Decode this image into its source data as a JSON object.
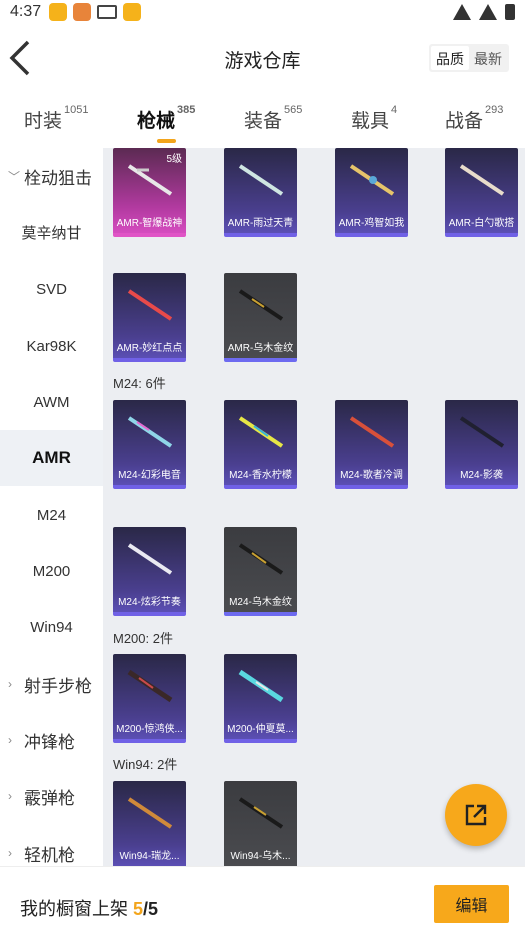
{
  "status": {
    "time": "4:37",
    "icons": [
      "app-icon",
      "app-icon",
      "mail-icon",
      "app-icon"
    ],
    "right_icons": [
      "wifi-icon",
      "signal-icon",
      "battery-icon"
    ]
  },
  "header": {
    "title": "游戏仓库",
    "sort_quality": "品质",
    "sort_newest": "最新"
  },
  "tabs": [
    {
      "label": "时装",
      "count": "1051"
    },
    {
      "label": "枪械",
      "count": "385"
    },
    {
      "label": "装备",
      "count": "565"
    },
    {
      "label": "载具",
      "count": "4"
    },
    {
      "label": "战备",
      "count": "293"
    }
  ],
  "sidebar": {
    "items": [
      {
        "label": "栓动狙击"
      },
      {
        "label": "莫辛纳甘"
      },
      {
        "label": "SVD"
      },
      {
        "label": "Kar98K"
      },
      {
        "label": "AWM"
      },
      {
        "label": "AMR"
      },
      {
        "label": "M24"
      },
      {
        "label": "M200"
      },
      {
        "label": "Win94"
      },
      {
        "label": "射手步枪"
      },
      {
        "label": "冲锋枪"
      },
      {
        "label": "霰弹枪"
      },
      {
        "label": "轻机枪"
      }
    ]
  },
  "sections": [
    {
      "title": "M24: 6件"
    },
    {
      "title": "M200: 2件"
    },
    {
      "title": "Win94: 2件"
    }
  ],
  "cards": [
    {
      "label": "AMR-智爆战神",
      "badge": "5级"
    },
    {
      "label": "AMR-雨过天青"
    },
    {
      "label": "AMR-鸡智如我"
    },
    {
      "label": "AMR-白勺歌搭"
    },
    {
      "label": "AMR-妙红点点"
    },
    {
      "label": "AMR-乌木金纹"
    },
    {
      "label": "M24-幻彩电音"
    },
    {
      "label": "M24-香水柠檬"
    },
    {
      "label": "M24-歌者冷调"
    },
    {
      "label": "M24-影袭"
    },
    {
      "label": "M24-炫彩节奏"
    },
    {
      "label": "M24-乌木金纹"
    },
    {
      "label": "M200-惊鸿侠..."
    },
    {
      "label": "M200-仲夏莫..."
    },
    {
      "label": "Win94-瑞龙..."
    },
    {
      "label": "Win94-乌木..."
    }
  ],
  "bottom": {
    "label": "我的橱窗上架",
    "current": "5",
    "separator": "/",
    "total": "5",
    "edit_label": "编辑"
  },
  "colors": {
    "accent": "#f7a81b",
    "purple_card": "#4a3f8f",
    "gray_card": "#4a4b4f",
    "pink_card": "#b23aa0"
  }
}
